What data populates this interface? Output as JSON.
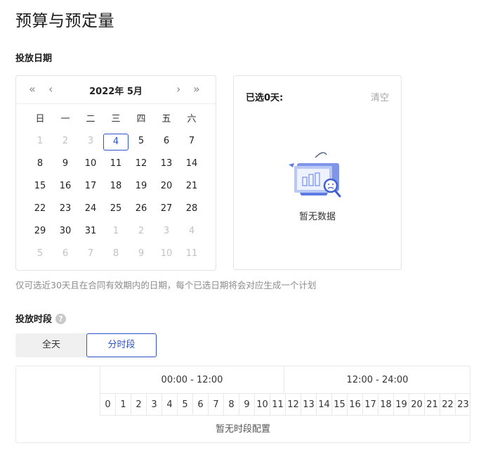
{
  "page": {
    "title": "预算与预定量"
  },
  "date_section": {
    "label": "投放日期"
  },
  "calendar": {
    "nav": {
      "prev_year": "«",
      "prev_month": "‹",
      "next_month": "›",
      "next_year": "»"
    },
    "title": "2022年 5月",
    "weekdays": [
      "日",
      "一",
      "二",
      "三",
      "四",
      "五",
      "六"
    ],
    "weeks": [
      [
        "1",
        "2",
        "3",
        "4",
        "5",
        "6",
        "7"
      ],
      [
        "8",
        "9",
        "10",
        "11",
        "12",
        "13",
        "14"
      ],
      [
        "15",
        "16",
        "17",
        "18",
        "19",
        "20",
        "21"
      ],
      [
        "22",
        "23",
        "24",
        "25",
        "26",
        "27",
        "28"
      ],
      [
        "29",
        "30",
        "31",
        "1",
        "2",
        "3",
        "4"
      ],
      [
        "5",
        "6",
        "7",
        "8",
        "9",
        "10",
        "11"
      ]
    ],
    "today": "4"
  },
  "selected": {
    "count_label": "已选0天:",
    "clear_label": "清空",
    "empty_text": "暂无数据"
  },
  "hint": "仅可选近30天且在合同有效期内的日期，每个已选日期将会对应生成一个计划",
  "time_section": {
    "label": "投放时段",
    "help_icon": "?"
  },
  "toggle": {
    "all_day": "全天",
    "by_segment": "分时段",
    "active": "分时段"
  },
  "time_table": {
    "am_range": "00:00 - 12:00",
    "pm_range": "12:00 - 24:00",
    "hours": [
      "0",
      "1",
      "2",
      "3",
      "4",
      "5",
      "6",
      "7",
      "8",
      "9",
      "10",
      "11",
      "12",
      "13",
      "14",
      "15",
      "16",
      "17",
      "18",
      "19",
      "20",
      "21",
      "22",
      "23"
    ],
    "empty_text": "暂无时段配置"
  },
  "colors": {
    "accent": "#2c53c9",
    "muted_text": "#c2c2c2",
    "border": "#e3e3e3"
  }
}
